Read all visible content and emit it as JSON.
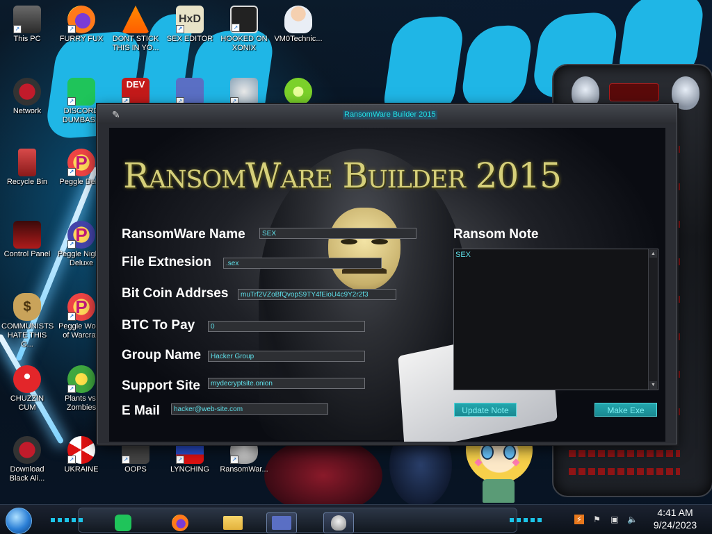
{
  "desktop": {
    "icons": [
      {
        "label": "This PC"
      },
      {
        "label": "FURRY FUX"
      },
      {
        "label": "DONT STICK THIS IN YO..."
      },
      {
        "label": "SEX EDITOR"
      },
      {
        "label": "HOOKED ON XONIX"
      },
      {
        "label": "VM0Technic..."
      },
      {
        "label": "Network"
      },
      {
        "label": "DISCORD DUMBASS"
      },
      {
        "label": "Recycle Bin"
      },
      {
        "label": "Peggle Del..."
      },
      {
        "label": "Control Panel"
      },
      {
        "label": "Peggle Nights Deluxe"
      },
      {
        "label": "COMMUNISTS HATE THIS G..."
      },
      {
        "label": "Peggle World of Warcraft"
      },
      {
        "label": "CHUZZIN CUM"
      },
      {
        "label": "Plants vs. Zombies"
      },
      {
        "label": "Download Black Ali..."
      },
      {
        "label": "UKRAINE"
      },
      {
        "label": "OOPS"
      },
      {
        "label": "LYNCHING"
      },
      {
        "label": "RansomWar..."
      }
    ]
  },
  "window": {
    "title": "RansomWare Builder 2015",
    "brand": "RansomWare Builder 2015",
    "form": {
      "name_label": "RansomWare Name",
      "name_value": "SEX",
      "ext_label": "File Extnesion",
      "ext_value": ".sex",
      "btc_addr_label": "Bit Coin Addrses",
      "btc_addr_value": "muTrf2VZoBfQvopS9TY4fEioU4c9Y2r2f3",
      "btc_pay_label": "BTC To Pay",
      "btc_pay_value": "0",
      "group_label": "Group Name",
      "group_value": "Hacker Group",
      "support_label": "Support Site",
      "support_value": "mydecryptsite.onion",
      "email_label": "E Mail",
      "email_value": "hacker@web-site.com"
    },
    "note": {
      "label": "Ransom Note",
      "text": "SEX"
    },
    "buttons": {
      "update": "Update Note",
      "make": "Make Exe"
    }
  },
  "taskbar": {
    "time": "4:41 AM",
    "date": "9/24/2023"
  },
  "colors": {
    "accent_cyan": "#21e3e8",
    "field_text": "#5fe0ea",
    "brand_gold": "#d6d07a"
  }
}
